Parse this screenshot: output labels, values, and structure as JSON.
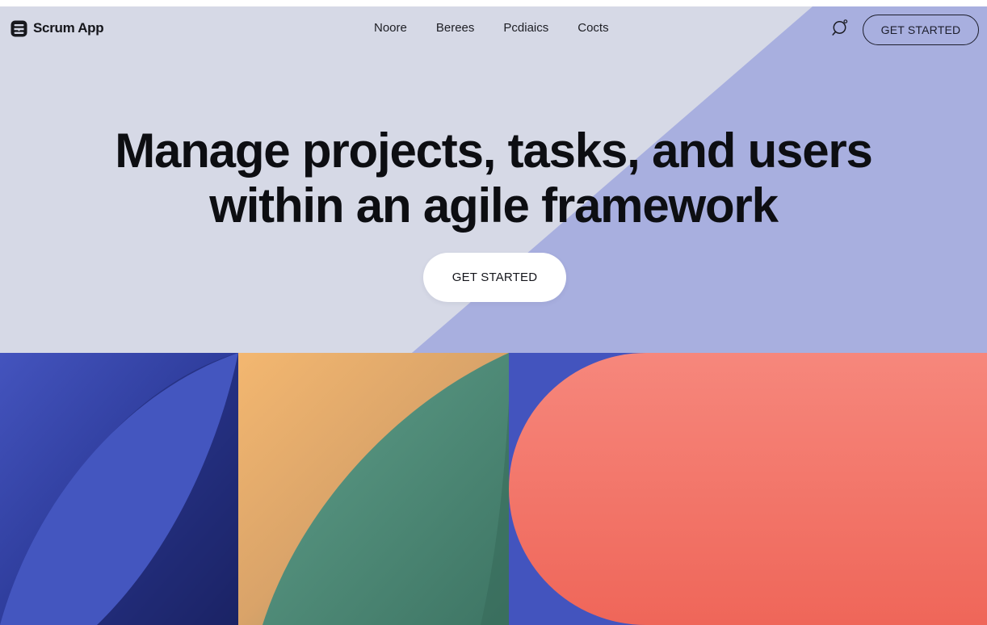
{
  "header": {
    "logo_text": "Scrum App",
    "logo_icon": "layers-icon",
    "nav": [
      {
        "label": "Noore"
      },
      {
        "label": "Berees"
      },
      {
        "label": "Pcdiaics"
      },
      {
        "label": "Cocts"
      }
    ],
    "search_icon": "search-icon",
    "cta_label": "GET STARTED"
  },
  "hero": {
    "headline_line1": "Manage projects, tasks, and users",
    "headline_line2": "within an agile framework",
    "cta_label": "GET STARTED"
  },
  "colors": {
    "hero_bg": "#d6d9e6",
    "hero_accent": "#a8afdf",
    "blue": "#4354be",
    "dark_blue": "#1f2970",
    "orange": "#f0b06c",
    "green": "#5b9a88",
    "coral": "#f07568"
  }
}
